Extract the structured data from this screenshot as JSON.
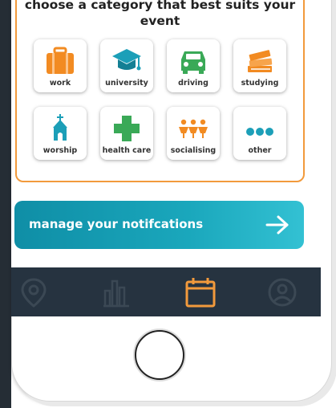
{
  "prompt": "choose a category that best suits your event",
  "categories": [
    {
      "label": "work",
      "icon": "briefcase-icon",
      "color": "#f28b22"
    },
    {
      "label": "university",
      "icon": "graduation-cap-icon",
      "color": "#1c9fb8"
    },
    {
      "label": "driving",
      "icon": "car-icon",
      "color": "#3aa957"
    },
    {
      "label": "studying",
      "icon": "books-icon",
      "color": "#f28b22"
    },
    {
      "label": "worship",
      "icon": "church-icon",
      "color": "#1c9fb8"
    },
    {
      "label": "health care",
      "icon": "medical-cross-icon",
      "color": "#3aa957"
    },
    {
      "label": "socialising",
      "icon": "people-icon",
      "color": "#f28b22"
    },
    {
      "label": "other",
      "icon": "dots-icon",
      "color": "#1c9fb8"
    }
  ],
  "manage": {
    "label": "manage your notifcations"
  },
  "nav": [
    {
      "icon": "location-pin-icon",
      "active": false
    },
    {
      "icon": "bar-chart-icon",
      "active": false
    },
    {
      "icon": "calendar-icon",
      "active": true
    },
    {
      "icon": "profile-icon",
      "active": false
    }
  ],
  "colors": {
    "accent": "#f29a3c",
    "nav_bg": "#263340",
    "button": "#1aa7bc"
  }
}
